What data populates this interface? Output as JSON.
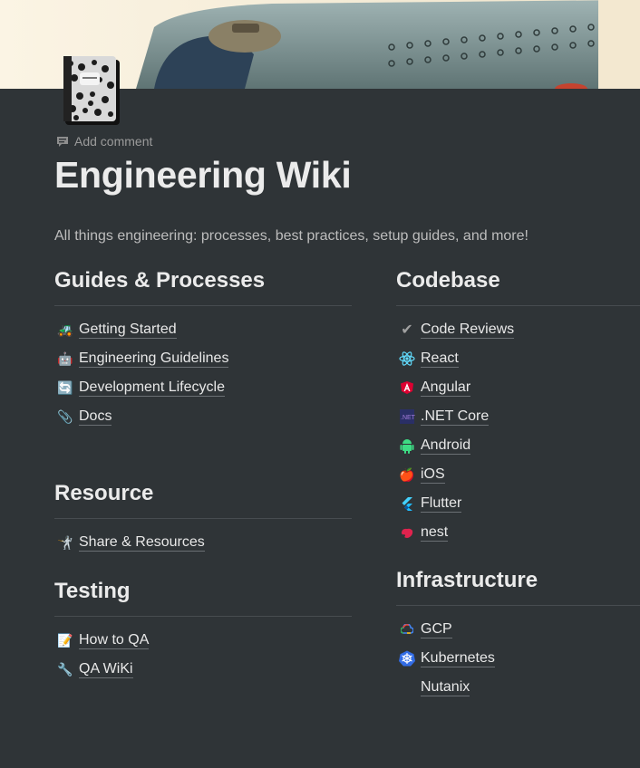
{
  "page": {
    "title": "Engineering Wiki",
    "description": "All things engineering: processes, best practices, setup guides, and more!",
    "add_comment_label": "Add comment"
  },
  "colors": {
    "background": "#2f3437",
    "text": "#e6e6e6",
    "muted": "#9b9b9b",
    "divider": "#474c50"
  },
  "sections": {
    "guides": {
      "heading": "Guides & Processes",
      "items": [
        {
          "label": "Getting Started",
          "icon": "tractor-icon"
        },
        {
          "label": "Engineering Guidelines",
          "icon": "robot-icon"
        },
        {
          "label": "Development Lifecycle",
          "icon": "cycle-icon"
        },
        {
          "label": "Docs",
          "icon": "paperclip-icon"
        }
      ]
    },
    "resource": {
      "heading": "Resource",
      "items": [
        {
          "label": "Share & Resources",
          "icon": "fencer-icon"
        }
      ]
    },
    "testing": {
      "heading": "Testing",
      "items": [
        {
          "label": "How to QA",
          "icon": "memo-icon"
        },
        {
          "label": "QA WiKi",
          "icon": "wrench-icon"
        }
      ]
    },
    "codebase": {
      "heading": "Codebase",
      "items": [
        {
          "label": "Code Reviews",
          "icon": "check-icon"
        },
        {
          "label": "React",
          "icon": "react-icon"
        },
        {
          "label": "Angular",
          "icon": "angular-icon"
        },
        {
          "label": ".NET Core",
          "icon": "dotnet-icon"
        },
        {
          "label": "Android",
          "icon": "android-icon"
        },
        {
          "label": "iOS",
          "icon": "apple-icon"
        },
        {
          "label": "Flutter",
          "icon": "flutter-icon"
        },
        {
          "label": "nest",
          "icon": "nest-icon"
        }
      ]
    },
    "infrastructure": {
      "heading": "Infrastructure",
      "items": [
        {
          "label": "GCP",
          "icon": "gcp-icon"
        },
        {
          "label": "Kubernetes",
          "icon": "kubernetes-icon"
        },
        {
          "label": "Nutanix",
          "icon": "nutanix-icon"
        }
      ]
    }
  }
}
